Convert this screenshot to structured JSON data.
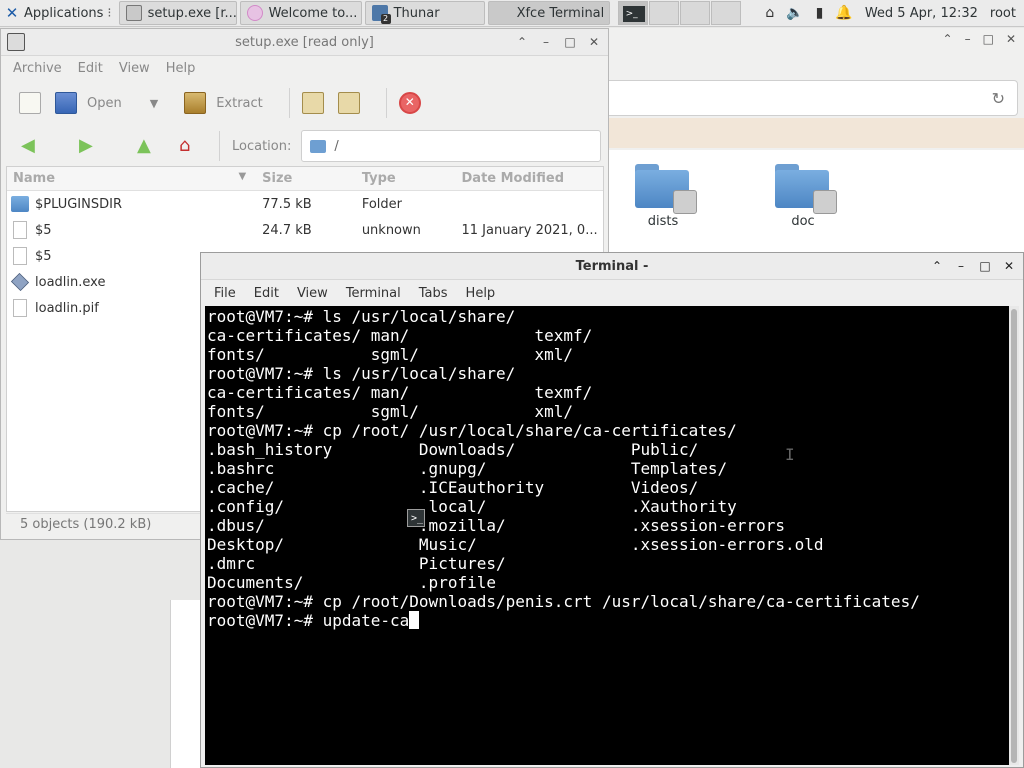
{
  "panel": {
    "applications_label": "Applications",
    "tasks": [
      {
        "label": "setup.exe [r...",
        "icon": "archive-icon"
      },
      {
        "label": "Welcome to...",
        "icon": "firefox-icon"
      },
      {
        "label": "Thunar",
        "icon": "folder-icon",
        "badge": "2"
      },
      {
        "label": "Xfce Terminal",
        "icon": "terminal-icon",
        "active": true
      }
    ],
    "clock": "Wed  5 Apr, 12:32",
    "user": "root"
  },
  "thunar": {
    "folders": [
      {
        "label": "dists"
      },
      {
        "label": "doc"
      }
    ]
  },
  "xarchiver": {
    "title": "setup.exe [read only]",
    "menus": [
      "Archive",
      "Edit",
      "View",
      "Help"
    ],
    "toolbar": {
      "open_label": "Open",
      "extract_label": "Extract"
    },
    "location_label": "Location:",
    "location_value": "/",
    "columns": {
      "name": "Name",
      "size": "Size",
      "type": "Type",
      "date": "Date Modified"
    },
    "files": [
      {
        "name": "$PLUGINSDIR",
        "size": "77.5 kB",
        "type": "Folder",
        "date": "",
        "icon": "folder"
      },
      {
        "name": "$5",
        "size": "24.7 kB",
        "type": "unknown",
        "date": "11 January 2021, 0...",
        "icon": "file"
      },
      {
        "name": "$5",
        "size": "",
        "type": "",
        "date": "",
        "icon": "file"
      },
      {
        "name": "loadlin.exe",
        "size": "",
        "type": "",
        "date": "",
        "icon": "exe"
      },
      {
        "name": "loadlin.pif",
        "size": "",
        "type": "",
        "date": "",
        "icon": "file"
      }
    ],
    "status": "5 objects (190.2 kB)"
  },
  "terminal": {
    "title": "Terminal -",
    "menus": [
      "File",
      "Edit",
      "View",
      "Terminal",
      "Tabs",
      "Help"
    ],
    "lines": [
      "root@VM7:~# ls /usr/local/share/",
      "ca-certificates/ man/             texmf/",
      "fonts/           sgml/            xml/",
      "root@VM7:~# ls /usr/local/share/",
      "ca-certificates/ man/             texmf/",
      "fonts/           sgml/            xml/",
      "root@VM7:~# cp /root/ /usr/local/share/ca-certificates/",
      ".bash_history         Downloads/            Public/",
      ".bashrc               .gnupg/               Templates/",
      ".cache/               .ICEauthority         Videos/",
      ".config/              .local/               .Xauthority",
      ".dbus/                .mozilla/             .xsession-errors",
      "Desktop/              Music/                .xsession-errors.old",
      ".dmrc                 Pictures/",
      "Documents/            .profile",
      "root@VM7:~# cp /root/Downloads/penis.crt /usr/local/share/ca-certificates/"
    ],
    "current_line": "root@VM7:~# update-ca"
  }
}
